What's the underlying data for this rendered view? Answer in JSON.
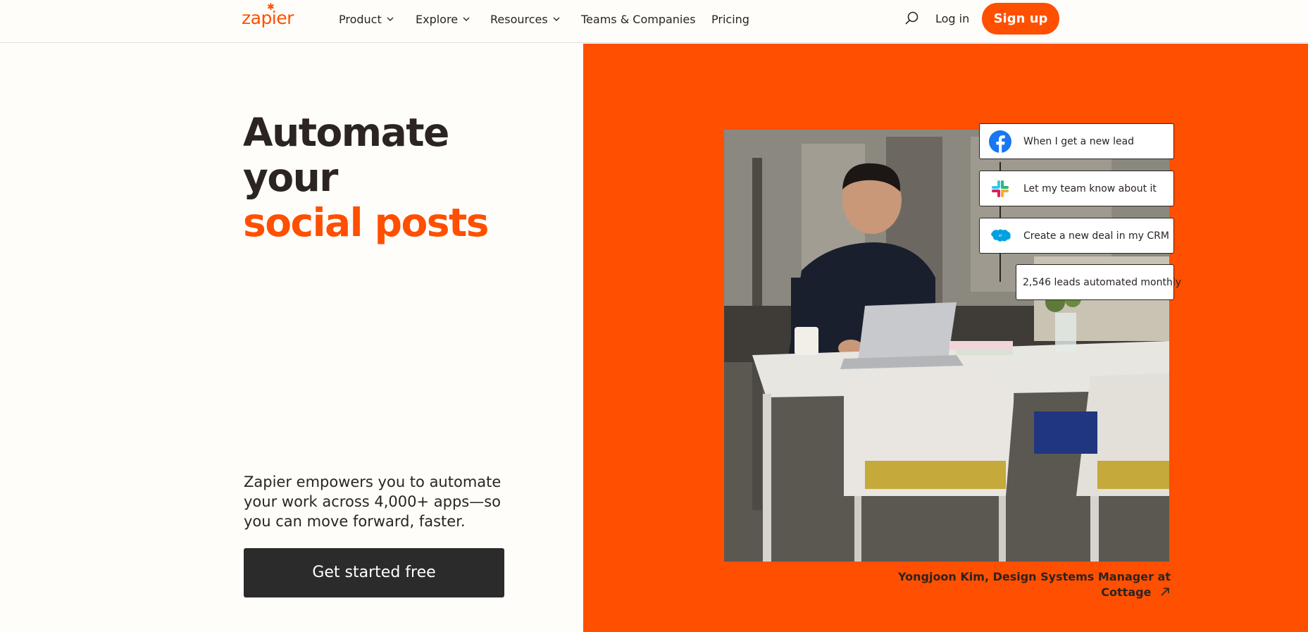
{
  "header": {
    "logo": "zapier",
    "nav": [
      {
        "label": "Product",
        "dropdown": true
      },
      {
        "label": "Explore",
        "dropdown": true
      },
      {
        "label": "Resources",
        "dropdown": true
      },
      {
        "label": "Teams & Companies",
        "dropdown": false
      },
      {
        "label": "Pricing",
        "dropdown": false
      }
    ],
    "search_icon": "search-icon",
    "login_label": "Log in",
    "signup_label": "Sign up"
  },
  "hero": {
    "title_line1": "Automate your",
    "title_line2": "social posts",
    "subtitle": "Zapier empowers you to automate your work across 4,000+ apps—so you can move forward, faster.",
    "cta_label": "Get started free"
  },
  "workflow": {
    "steps": [
      {
        "icon": "facebook-icon",
        "label": "When I get a new lead"
      },
      {
        "icon": "slack-icon",
        "label": "Let my team know about it"
      },
      {
        "icon": "salesforce-icon",
        "label": "Create a new deal in my CRM"
      }
    ],
    "stat": "2,546 leads automated monthly"
  },
  "testimonial": {
    "caption": "Yongjoon Kim, Design Systems Manager at Cottage"
  },
  "colors": {
    "brand": "#ff4f00",
    "background": "#fffdf9",
    "text": "#2b2421",
    "cta": "#2b2b2b"
  }
}
